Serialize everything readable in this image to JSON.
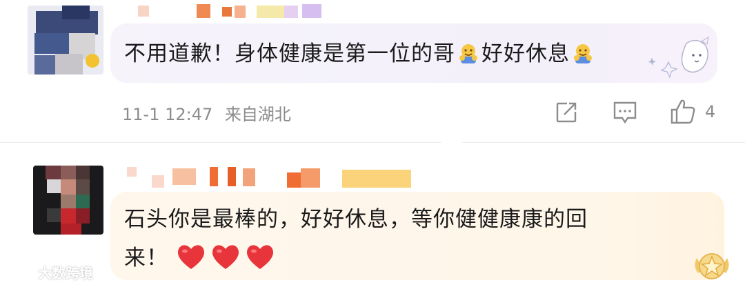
{
  "comments": [
    {
      "text_a": "不用道歉！身体健康是第一位的哥",
      "text_b": "好好休息",
      "emoji": "hugging-face-emoji",
      "time": "11-1 12:47",
      "location": "来自湖北",
      "like_count": "4"
    },
    {
      "line1": "石头你是最棒的，好好休息，等你健健康康的回",
      "line2": "来！",
      "hearts": "red-heart-emoji"
    }
  ],
  "watermark": "大数跨境",
  "colors": {
    "bubble1": "#f4f1fa",
    "bubble2": "#fff6ea",
    "meta_text": "#8c8c8c",
    "heart": "#e8353b"
  }
}
